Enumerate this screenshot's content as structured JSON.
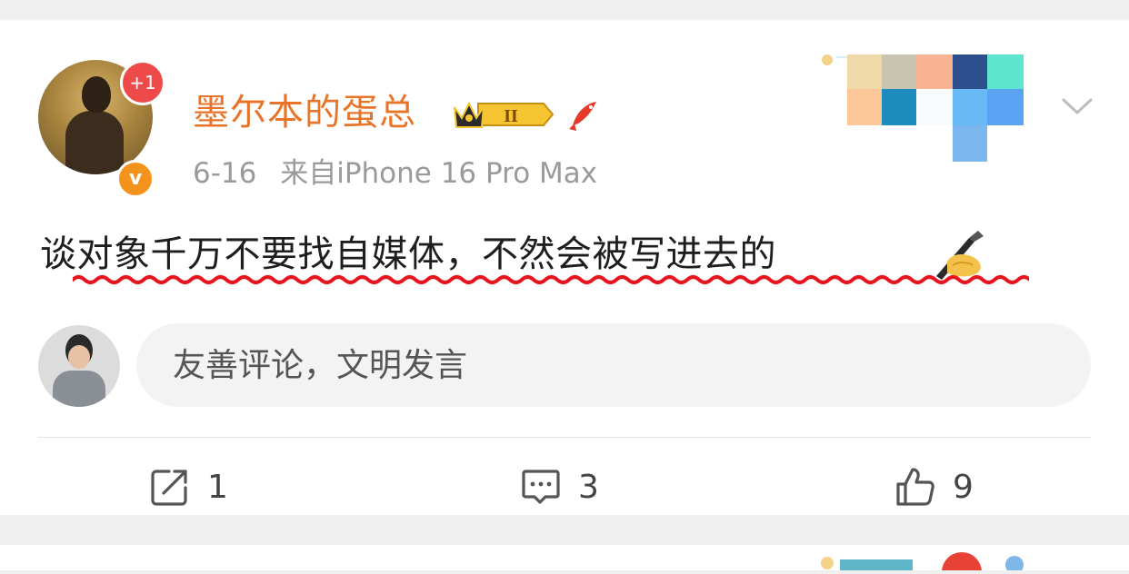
{
  "post": {
    "author": "墨尔本的蛋总",
    "member_badge_level": "II",
    "follow_badge": "+1",
    "verified_badge": "v",
    "date": "6-16",
    "source": "来自iPhone 16 Pro Max",
    "text": "谈对象千万不要找自媒体，不然会被写进去的",
    "emoji": "writing-hand-emoji"
  },
  "comment_box": {
    "placeholder": "友善评论，文明发言"
  },
  "actions": {
    "repost_count": "1",
    "comment_count": "3",
    "like_count": "9"
  },
  "colors": {
    "username": "#e8742a",
    "underline": "#e8141e",
    "verified": "#f3931c",
    "follow_badge": "#ef4a4a"
  },
  "icons": [
    "chevron-down-icon",
    "crown-badge-icon",
    "koi-icon",
    "repost-icon",
    "comment-icon",
    "like-icon"
  ]
}
